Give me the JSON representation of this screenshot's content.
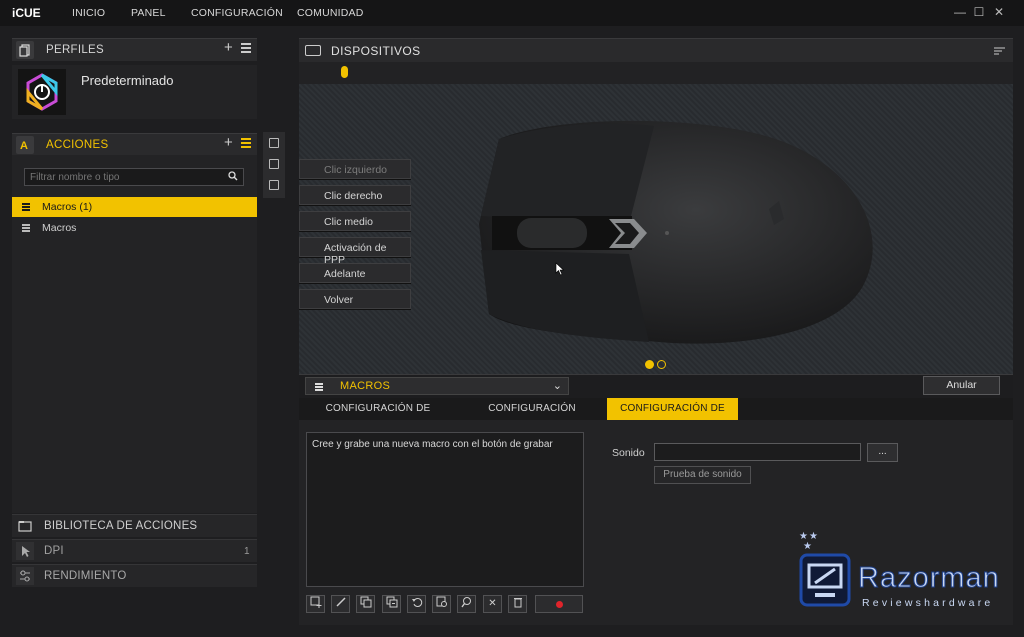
{
  "app": {
    "title": "iCUE"
  },
  "nav": [
    "INICIO",
    "PANEL",
    "CONFIGURACIÓN",
    "COMUNIDAD"
  ],
  "window_controls": {
    "minimize": "—",
    "maximize": "☐",
    "close": "✕"
  },
  "profiles": {
    "header": "PERFILES",
    "items": [
      {
        "name": "Predeterminado"
      }
    ]
  },
  "actions": {
    "header": "ACCIONES",
    "filter_placeholder": "Filtrar nombre o tipo",
    "items": [
      {
        "label": "Macros (1)",
        "selected": true
      },
      {
        "label": "Macros",
        "selected": false
      }
    ]
  },
  "left_bottom": {
    "library": "BIBLIOTECA DE ACCIONES",
    "dpi": {
      "label": "DPI",
      "value": "1"
    },
    "performance": "RENDIMIENTO"
  },
  "devices": {
    "header": "DISPOSITIVOS",
    "buttons": [
      {
        "label": "Clic izquierdo",
        "disabled": true
      },
      {
        "label": "Clic derecho",
        "disabled": false
      },
      {
        "label": "Clic medio",
        "disabled": false
      },
      {
        "label": "Activación de PPP",
        "disabled": false
      },
      {
        "label": "Adelante",
        "disabled": false
      },
      {
        "label": "Volver",
        "disabled": false
      }
    ]
  },
  "macro_panel": {
    "selector": "MACROS",
    "cancel": "Anular",
    "tabs": [
      {
        "label": "CONFIGURACIÓN DE GRABACIÓN",
        "active": false
      },
      {
        "label": "CONFIGURACIÓN AVANZADA",
        "active": false
      },
      {
        "label": "CONFIGURACIÓN DE INICIO",
        "active": true
      }
    ],
    "macro_hint": "Cree y grabe una nueva macro con el botón de grabar",
    "sound_label": "Sonido",
    "sound_value": "",
    "browse": "...",
    "test_sound": "Prueba de sonido"
  },
  "watermark": {
    "brand": "Razorman",
    "subtitle": "Reviewshardware"
  },
  "colors": {
    "accent": "#f2c200",
    "record": "#e0242b",
    "background": "#1e1e20"
  }
}
